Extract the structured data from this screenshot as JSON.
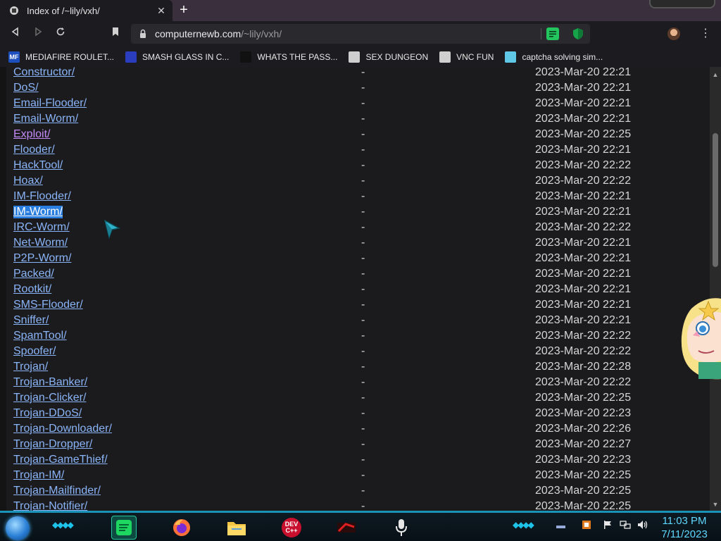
{
  "browser": {
    "tab_title": "Index of /~lily/vxh/",
    "tab_close": "✕",
    "new_tab": "+",
    "url_host": "computernewb.com",
    "url_path": "/~lily/vxh/",
    "menu": "⋮"
  },
  "bookmarks": [
    {
      "label": "MEDIAFIRE ROULET...",
      "icon": "mediafire-icon",
      "icon_text": "MF",
      "color": "#1d4fbf"
    },
    {
      "label": "SMASH GLASS IN C...",
      "icon": "chevron-logo-icon",
      "icon_text": "",
      "color": "#2b3dbf"
    },
    {
      "label": "WHATS THE PASS...",
      "icon": "dark-square-icon",
      "icon_text": "",
      "color": "#111111"
    },
    {
      "label": "SEX DUNGEON",
      "icon": "gear-shield-icon",
      "icon_text": "",
      "color": "#cfcfcf"
    },
    {
      "label": "VNC FUN",
      "icon": "gear-shield-icon",
      "icon_text": "",
      "color": "#cfcfcf"
    },
    {
      "label": "captcha solving sim...",
      "icon": "lambda-icon",
      "icon_text": "",
      "color": "#5ec8e6"
    }
  ],
  "listing": [
    {
      "name": "Constructor/",
      "size": "-",
      "date": "2023-Mar-20 22:21",
      "state": "normal"
    },
    {
      "name": "DoS/",
      "size": "-",
      "date": "2023-Mar-20 22:21",
      "state": "normal"
    },
    {
      "name": "Email-Flooder/",
      "size": "-",
      "date": "2023-Mar-20 22:21",
      "state": "normal"
    },
    {
      "name": "Email-Worm/",
      "size": "-",
      "date": "2023-Mar-20 22:21",
      "state": "normal"
    },
    {
      "name": "Exploit/",
      "size": "-",
      "date": "2023-Mar-20 22:25",
      "state": "visited"
    },
    {
      "name": "Flooder/",
      "size": "-",
      "date": "2023-Mar-20 22:21",
      "state": "normal"
    },
    {
      "name": "HackTool/",
      "size": "-",
      "date": "2023-Mar-20 22:22",
      "state": "normal"
    },
    {
      "name": "Hoax/",
      "size": "-",
      "date": "2023-Mar-20 22:22",
      "state": "normal"
    },
    {
      "name": "IM-Flooder/",
      "size": "-",
      "date": "2023-Mar-20 22:21",
      "state": "normal"
    },
    {
      "name": "IM-Worm/",
      "size": "-",
      "date": "2023-Mar-20 22:21",
      "state": "selected"
    },
    {
      "name": "IRC-Worm/",
      "size": "-",
      "date": "2023-Mar-20 22:22",
      "state": "normal"
    },
    {
      "name": "Net-Worm/",
      "size": "-",
      "date": "2023-Mar-20 22:21",
      "state": "normal"
    },
    {
      "name": "P2P-Worm/",
      "size": "-",
      "date": "2023-Mar-20 22:21",
      "state": "normal"
    },
    {
      "name": "Packed/",
      "size": "-",
      "date": "2023-Mar-20 22:21",
      "state": "normal"
    },
    {
      "name": "Rootkit/",
      "size": "-",
      "date": "2023-Mar-20 22:21",
      "state": "normal"
    },
    {
      "name": "SMS-Flooder/",
      "size": "-",
      "date": "2023-Mar-20 22:21",
      "state": "normal"
    },
    {
      "name": "Sniffer/",
      "size": "-",
      "date": "2023-Mar-20 22:21",
      "state": "normal"
    },
    {
      "name": "SpamTool/",
      "size": "-",
      "date": "2023-Mar-20 22:22",
      "state": "normal"
    },
    {
      "name": "Spoofer/",
      "size": "-",
      "date": "2023-Mar-20 22:22",
      "state": "normal"
    },
    {
      "name": "Trojan/",
      "size": "-",
      "date": "2023-Mar-20 22:28",
      "state": "normal"
    },
    {
      "name": "Trojan-Banker/",
      "size": "-",
      "date": "2023-Mar-20 22:22",
      "state": "normal"
    },
    {
      "name": "Trojan-Clicker/",
      "size": "-",
      "date": "2023-Mar-20 22:25",
      "state": "normal"
    },
    {
      "name": "Trojan-DDoS/",
      "size": "-",
      "date": "2023-Mar-20 22:23",
      "state": "normal"
    },
    {
      "name": "Trojan-Downloader/",
      "size": "-",
      "date": "2023-Mar-20 22:26",
      "state": "normal"
    },
    {
      "name": "Trojan-Dropper/",
      "size": "-",
      "date": "2023-Mar-20 22:27",
      "state": "normal"
    },
    {
      "name": "Trojan-GameThief/",
      "size": "-",
      "date": "2023-Mar-20 22:23",
      "state": "normal"
    },
    {
      "name": "Trojan-IM/",
      "size": "-",
      "date": "2023-Mar-20 22:25",
      "state": "normal"
    },
    {
      "name": "Trojan-Mailfinder/",
      "size": "-",
      "date": "2023-Mar-20 22:25",
      "state": "normal"
    },
    {
      "name": "Trojan-Notifier/",
      "size": "-",
      "date": "2023-Mar-20 22:25",
      "state": "normal"
    }
  ],
  "taskbar": {
    "apps": [
      {
        "name": "spotify-icon",
        "active": true
      },
      {
        "name": "firefox-icon",
        "active": false
      },
      {
        "name": "file-explorer-icon",
        "active": false
      },
      {
        "name": "dev-cpp-icon",
        "active": false,
        "label": "DEV C++"
      },
      {
        "name": "red-app-icon",
        "active": false
      },
      {
        "name": "microphone-icon",
        "active": false
      }
    ],
    "clock_time": "11:03 PM",
    "clock_date": "7/11/2023"
  },
  "colors": {
    "link": "#8ab4f8",
    "visited": "#c58af9",
    "selection": "#2a7ee0",
    "taskbar_accent": "#1b93b8"
  }
}
